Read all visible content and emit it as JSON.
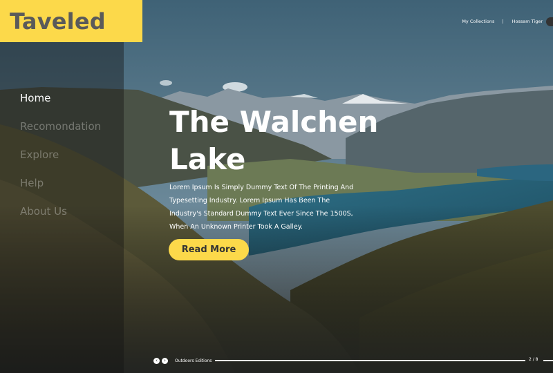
{
  "brand": {
    "logo_text": "Taveled"
  },
  "sidebar": {
    "items": [
      {
        "label": "Home",
        "active": true
      },
      {
        "label": "Recomondation",
        "active": false
      },
      {
        "label": "Explore",
        "active": false
      },
      {
        "label": "Help",
        "active": false
      },
      {
        "label": "About Us",
        "active": false
      }
    ]
  },
  "topnav": {
    "collections": "My Collections",
    "separator": "|",
    "user": "Hossam Tiger"
  },
  "hero": {
    "title": "The Walchen Lake",
    "description": "Lorem Ipsum Is Simply Dummy Text Of The Printing And Typesetting Industry. Lorem Ipsum Has Been The Industry's Standard Dummy Text Ever Since The 1500S, When An Unknown Printer Took A Galley.",
    "cta": "Read More"
  },
  "footer": {
    "prev_icon": "chevron-left-icon",
    "next_icon": "chevron-right-icon",
    "label": "Outdoors Editions",
    "pager": "2 / 8"
  },
  "colors": {
    "accent": "#fcd94a",
    "logo_text": "#5a5a5a"
  }
}
